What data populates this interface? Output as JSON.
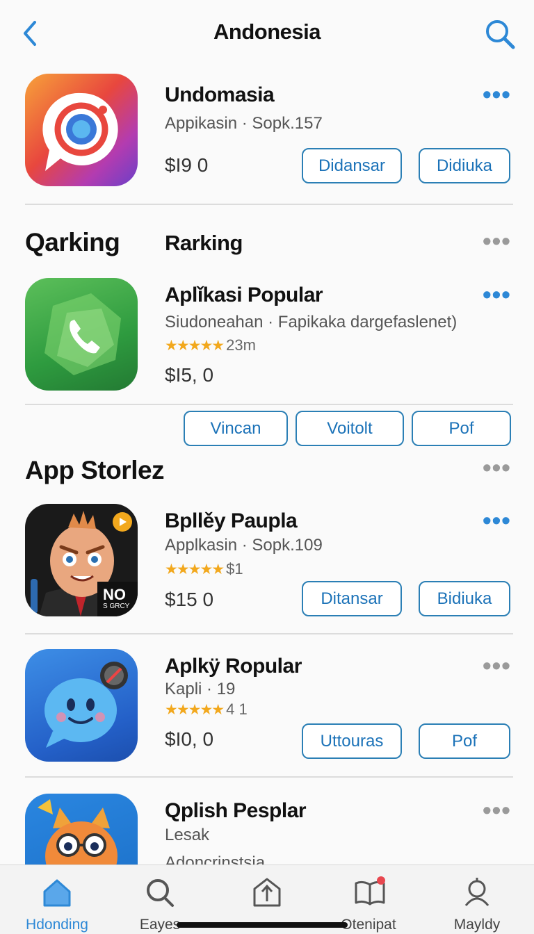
{
  "header": {
    "title": "Andonesia"
  },
  "top_app": {
    "name": "Undomasia",
    "subtitle": "Appikasin · Sopk.157",
    "price": "$I9 0",
    "btn1": "Didansar",
    "btn2": "Didiuka"
  },
  "ranking": {
    "section_left": "Qarking",
    "section_right": "Rarking",
    "app": {
      "name": "Aplǐkasi Popular",
      "subtitle": "Siudoneahan · Fapikaka dargefaslenet)",
      "rating_count": "23m",
      "price": "$I5, 0"
    },
    "buttons": [
      "Vincan",
      "Voitolt",
      "Pof"
    ]
  },
  "stores": {
    "title": "App Storlez",
    "apps": [
      {
        "name": "Bpllěy Paupla",
        "subtitle": "Applkasin · Sopk.109",
        "rating_count": "$1",
        "price": "$15 0",
        "btn1": "Ditansar",
        "btn2": "Bidiuka",
        "badge": "NO",
        "badge_sub": "S GRCY"
      },
      {
        "name": "Aplkÿ Ropular",
        "subtitle": "Kapli · 19",
        "rating_count": "4 1",
        "price": "$I0, 0",
        "btn1": "Uttouras",
        "btn2": "Pof"
      },
      {
        "name": "Qplish Pesplar",
        "subtitle": "Lesak",
        "subtitle2": "Adoncrinstsia"
      }
    ]
  },
  "tabs": [
    {
      "label": "Hdonding",
      "icon": "home-icon",
      "active": true
    },
    {
      "label": "Eayes",
      "icon": "search-icon"
    },
    {
      "label": "",
      "icon": "upload-icon"
    },
    {
      "label": "Otenipat",
      "icon": "book-icon"
    },
    {
      "label": "Mayldy",
      "icon": "profile-icon"
    }
  ],
  "colors": {
    "accent": "#2d88d6",
    "star": "#f2a81d",
    "button_border": "#2b7fb5"
  }
}
